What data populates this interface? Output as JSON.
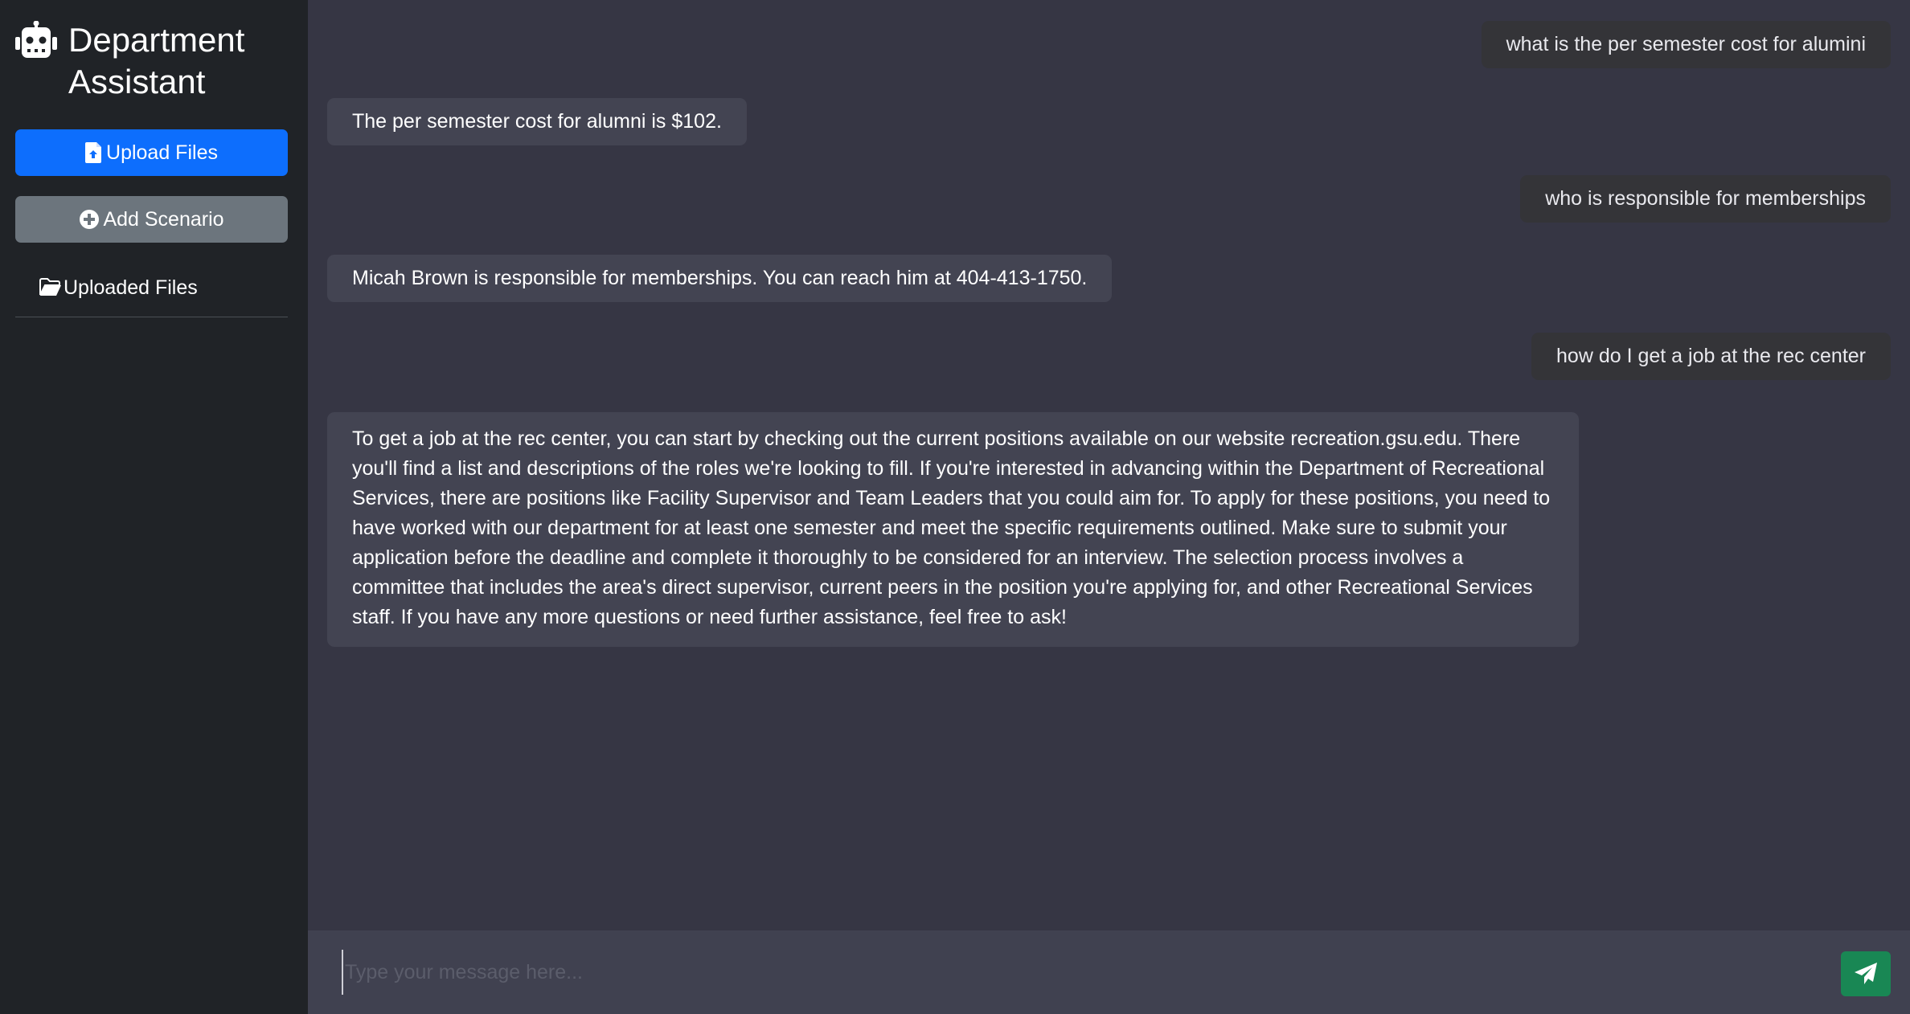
{
  "sidebar": {
    "title": "Department Assistant",
    "upload_button": "Upload Files",
    "add_scenario_button": "Add Scenario",
    "uploaded_files_label": "Uploaded Files",
    "icons": {
      "brand": "robot-icon",
      "upload": "file-upload-icon",
      "add": "plus-circle-icon",
      "folder": "folder-open-icon"
    }
  },
  "chat": {
    "messages": [
      {
        "role": "user",
        "text": "what is the per semester cost for alumini"
      },
      {
        "role": "assistant",
        "text": "The per semester cost for alumni is $102."
      },
      {
        "role": "user",
        "text": "who is responsible for memberships"
      },
      {
        "role": "assistant",
        "text": "Micah Brown is responsible for memberships. You can reach him at 404-413-1750."
      },
      {
        "role": "user",
        "text": "how do I get a job at the rec center"
      },
      {
        "role": "assistant",
        "text": "To get a job at the rec center, you can start by checking out the current positions available on our website recreation.gsu.edu. There you'll find a list and descriptions of the roles we're looking to fill. If you're interested in advancing within the Department of Recreational Services, there are positions like Facility Supervisor and Team Leaders that you could aim for. To apply for these positions, you need to have worked with our department for at least one semester and meet the specific requirements outlined. Make sure to submit your application before the deadline and complete it thoroughly to be considered for an interview. The selection process involves a committee that includes the area's direct supervisor, current peers in the position you're applying for, and other Recreational Services staff. If you have any more questions or need further assistance, feel free to ask!"
      }
    ]
  },
  "input": {
    "placeholder": "Type your message here...",
    "value": "",
    "send_icon": "paper-plane-icon"
  },
  "colors": {
    "sidebar_bg": "#202327",
    "chat_bg": "#363644",
    "user_bubble": "#343438",
    "bot_bubble": "#434452",
    "upload_button": "#0d6efd",
    "scenario_button": "#6c757d",
    "send_button": "#198754"
  }
}
